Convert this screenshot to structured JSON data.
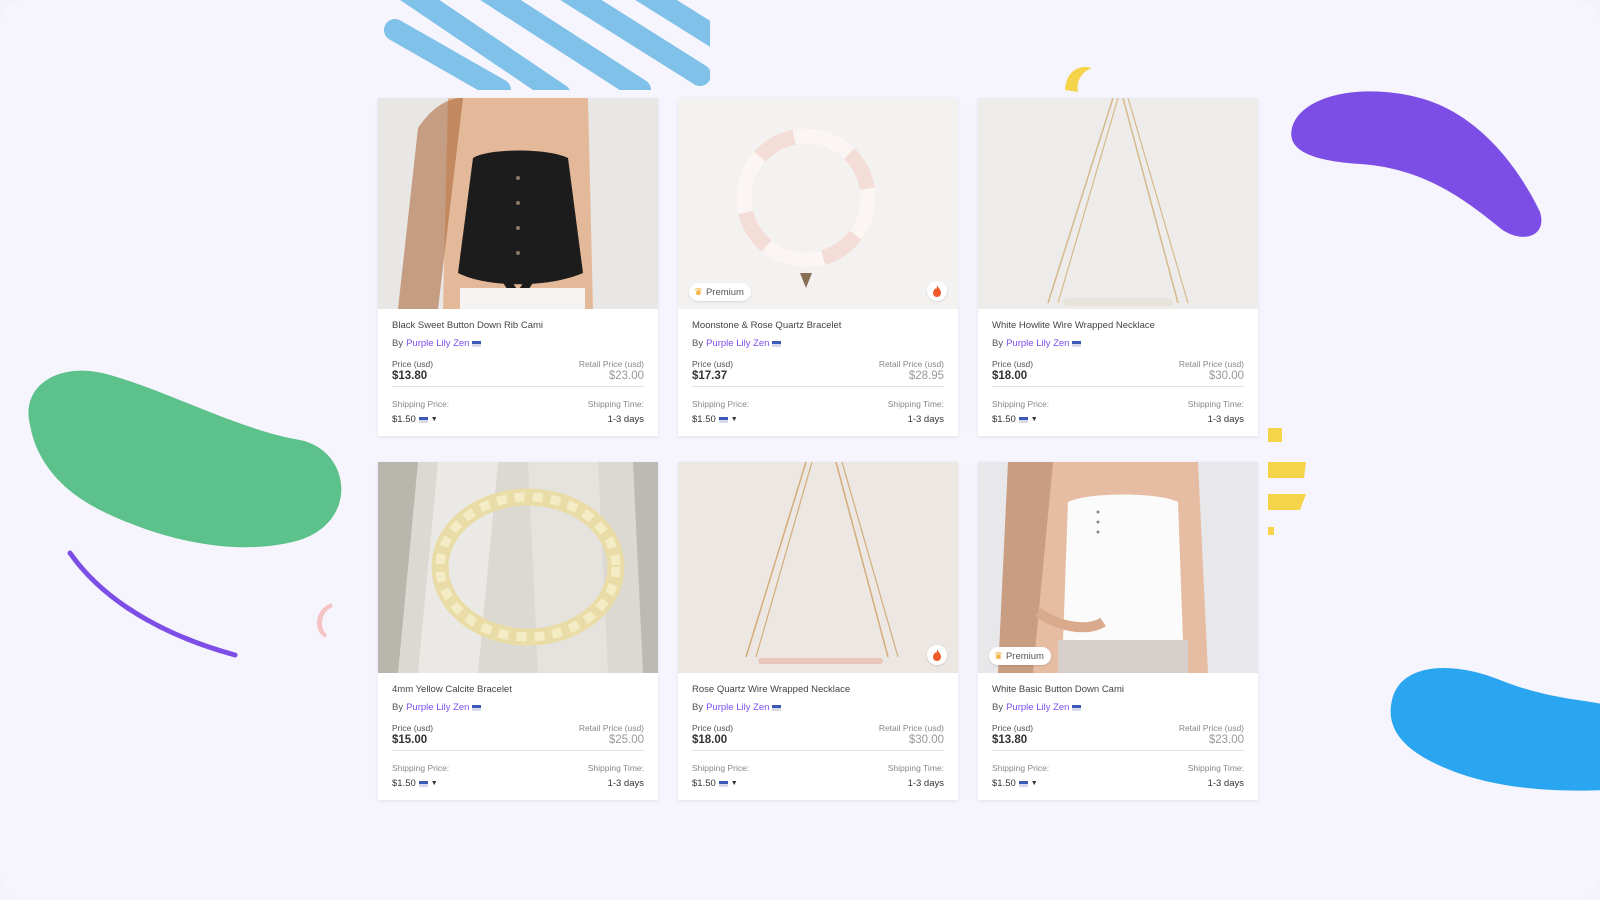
{
  "colors": {
    "vendor_link": "#7b4ef0",
    "blob_purple": "#7c4ee6",
    "blob_green": "#5cc18a",
    "blob_blue": "#2aa5f0",
    "blob_yellow": "#f5d44a",
    "stripes_blue": "#7fc1e8",
    "moon_pink": "#f4c3c3"
  },
  "labels": {
    "price": "Price (usd)",
    "retail": "Retail Price (usd)",
    "shipping_price": "Shipping Price:",
    "shipping_time": "Shipping Time:",
    "by": "By",
    "premium": "Premium"
  },
  "products": [
    {
      "title": "Black Sweet Button Down Rib Cami",
      "vendor": "Purple Lily Zen",
      "price": "$13.80",
      "retail": "$23.00",
      "shipping_price": "$1.50",
      "shipping_time": "1-3 days",
      "premium": false,
      "hot": false,
      "image": "black-cami-photo"
    },
    {
      "title": "Moonstone & Rose Quartz Bracelet",
      "vendor": "Purple Lily Zen",
      "price": "$17.37",
      "retail": "$28.95",
      "shipping_price": "$1.50",
      "shipping_time": "1-3 days",
      "premium": true,
      "hot": true,
      "image": "rose-quartz-bracelet-photo"
    },
    {
      "title": "White Howlite Wire Wrapped Necklace",
      "vendor": "Purple Lily Zen",
      "price": "$18.00",
      "retail": "$30.00",
      "shipping_price": "$1.50",
      "shipping_time": "1-3 days",
      "premium": false,
      "hot": false,
      "image": "howlite-necklace-photo"
    },
    {
      "title": "4mm Yellow Calcite Bracelet",
      "vendor": "Purple Lily Zen",
      "price": "$15.00",
      "retail": "$25.00",
      "shipping_price": "$1.50",
      "shipping_time": "1-3 days",
      "premium": false,
      "hot": false,
      "image": "calcite-bracelet-photo"
    },
    {
      "title": "Rose Quartz Wire Wrapped Necklace",
      "vendor": "Purple Lily Zen",
      "price": "$18.00",
      "retail": "$30.00",
      "shipping_price": "$1.50",
      "shipping_time": "1-3 days",
      "premium": false,
      "hot": true,
      "image": "rose-quartz-necklace-photo"
    },
    {
      "title": "White Basic Button Down Cami",
      "vendor": "Purple Lily Zen",
      "price": "$13.80",
      "retail": "$23.00",
      "shipping_price": "$1.50",
      "shipping_time": "1-3 days",
      "premium": true,
      "hot": false,
      "image": "white-cami-photo"
    }
  ]
}
